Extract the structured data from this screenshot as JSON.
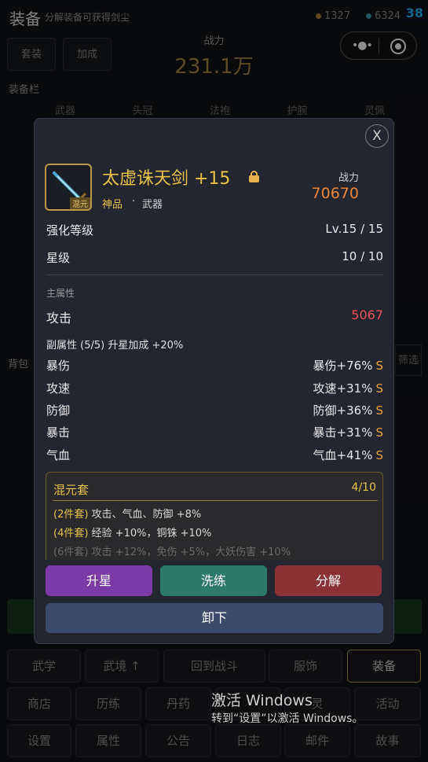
{
  "header": {
    "title": "装备",
    "hint": "分解装备可获得剑尘",
    "currency_a": "1327",
    "currency_b": "6324",
    "badge": "38"
  },
  "background": {
    "set_button": "套装",
    "bonus_button": "加成",
    "power_label": "战力",
    "power_value": "231.1万",
    "slot_title": "装备栏",
    "slots": [
      "武器",
      "头冠",
      "法袍",
      "护腕",
      "灵佩"
    ],
    "bag_label": "背包",
    "filter_label": "筛选"
  },
  "nav": {
    "row1": [
      "武学",
      "武境 ↑",
      "回到战斗",
      "服饰",
      "装备"
    ],
    "row2": [
      "商店",
      "历练",
      "丹药",
      "",
      "灵",
      "活动"
    ],
    "row3": [
      "设置",
      "属性",
      "公告",
      "日志",
      "邮件",
      "故事"
    ]
  },
  "watermark": {
    "line1": "激活 Windows",
    "line2": "转到“设置”以激活 Windows。"
  },
  "modal": {
    "close": "X",
    "item": {
      "name": "太虚诛天剑 +15",
      "quality": "神品",
      "dot": "·",
      "type": "武器",
      "icon_tag": "混元",
      "power_label": "战力",
      "power_value": "70670"
    },
    "enhance_label": "强化等级",
    "enhance_value": "Lv.15 / 15",
    "star_label": "星级",
    "star_value": "10 / 10",
    "main_attr_label": "主属性",
    "main_attr_name": "攻击",
    "main_attr_value": "5067",
    "sub_attr_header": "副属性 (5/5)  升星加成 +20%",
    "sub_attrs": [
      {
        "name": "暴伤",
        "value": "暴伤+76%",
        "grade": "S"
      },
      {
        "name": "攻速",
        "value": "攻速+31%",
        "grade": "S"
      },
      {
        "name": "防御",
        "value": "防御+36%",
        "grade": "S"
      },
      {
        "name": "暴击",
        "value": "暴击+31%",
        "grade": "S"
      },
      {
        "name": "气血",
        "value": "气血+41%",
        "grade": "S"
      }
    ],
    "set": {
      "name": "混元套",
      "count": "4/10",
      "bonuses": [
        {
          "key": "(2件套)",
          "text": " 攻击、气血、防御 +8%"
        },
        {
          "key": "(4件套)",
          "text": " 经验 +10%，铜铢 +10%"
        },
        {
          "key": "(6件套)",
          "text": " 攻击 +12%，免伤 +5%，大妖伤害 +10%"
        }
      ]
    },
    "actions": {
      "star_up": "升星",
      "reroll": "洗练",
      "dismantle": "分解",
      "unequip": "卸下"
    }
  },
  "colors": {
    "gold": "#e6c24a",
    "power_orange": "#e8873a",
    "red_value": "#e8505a",
    "star_purple": "#7b3aa6",
    "reroll_teal": "#2d7a6c",
    "dismantle_red": "#8a3236",
    "unequip_blue": "#3c4b69"
  }
}
